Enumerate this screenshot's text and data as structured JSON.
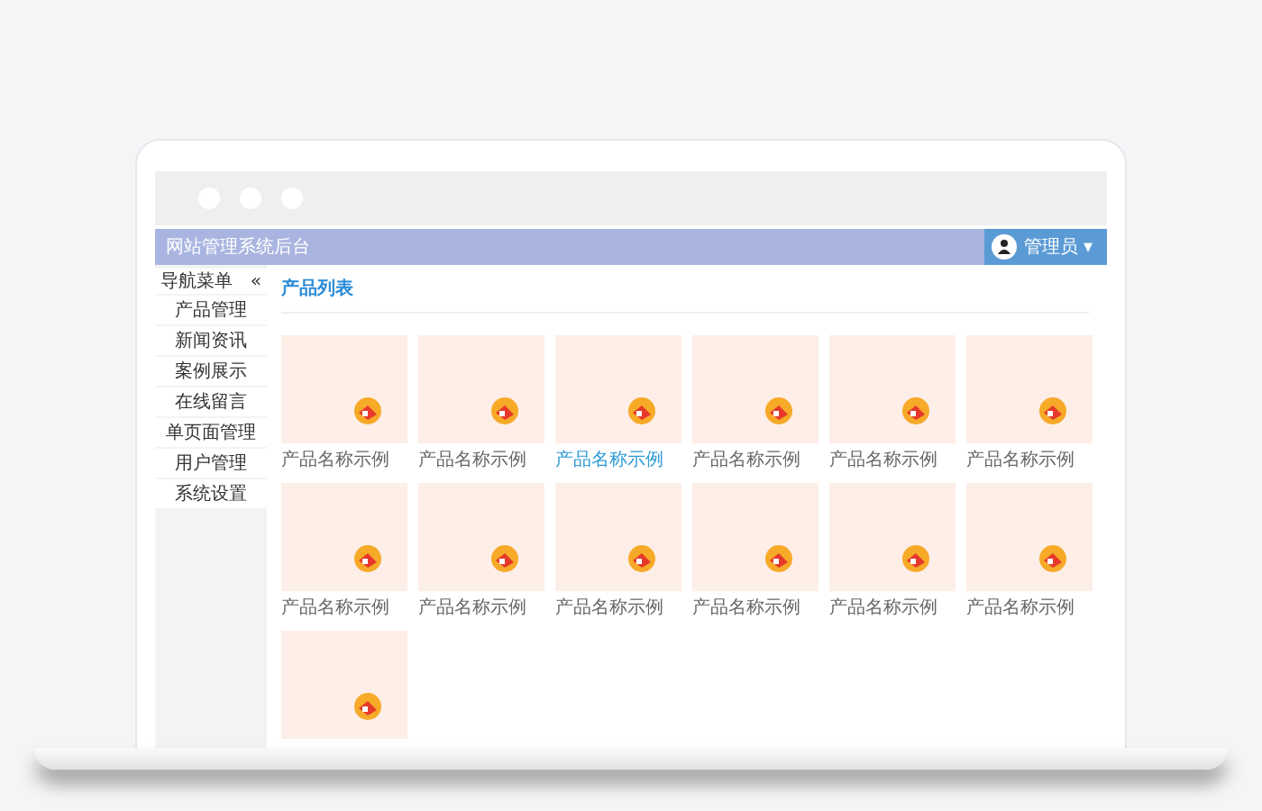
{
  "header": {
    "title": "网站管理系统后台",
    "user": "管理员",
    "caret": "▾"
  },
  "sidebar": {
    "title": "导航菜单",
    "collapse": "«",
    "items": [
      {
        "label": "产品管理"
      },
      {
        "label": "新闻资讯"
      },
      {
        "label": "案例展示"
      },
      {
        "label": "在线留言"
      },
      {
        "label": "单页面管理"
      },
      {
        "label": "用户管理"
      },
      {
        "label": "系统设置"
      }
    ]
  },
  "page_title": "产品列表",
  "products": [
    {
      "kind": "captioned",
      "caption": "产品名称示例",
      "selected": false
    },
    {
      "kind": "captioned",
      "caption": "产品名称示例",
      "selected": false
    },
    {
      "kind": "captioned",
      "caption": "产品名称示例",
      "selected": true
    },
    {
      "kind": "captioned",
      "caption": "产品名称示例",
      "selected": false
    },
    {
      "kind": "captioned",
      "caption": "产品名称示例",
      "selected": false
    },
    {
      "kind": "captioned",
      "caption": "产品名称示例",
      "selected": false
    },
    {
      "kind": "captioned",
      "caption": "产品名称示例",
      "selected": false
    },
    {
      "kind": "captioned",
      "caption": "产品名称示例",
      "selected": false
    },
    {
      "kind": "captioned",
      "caption": "产品名称示例",
      "selected": false
    },
    {
      "kind": "captioned",
      "caption": "产品名称示例",
      "selected": false
    },
    {
      "kind": "captioned",
      "caption": "产品名称示例",
      "selected": false
    },
    {
      "kind": "captioned",
      "caption": "产品名称示例",
      "selected": false
    },
    {
      "kind": "image"
    }
  ]
}
